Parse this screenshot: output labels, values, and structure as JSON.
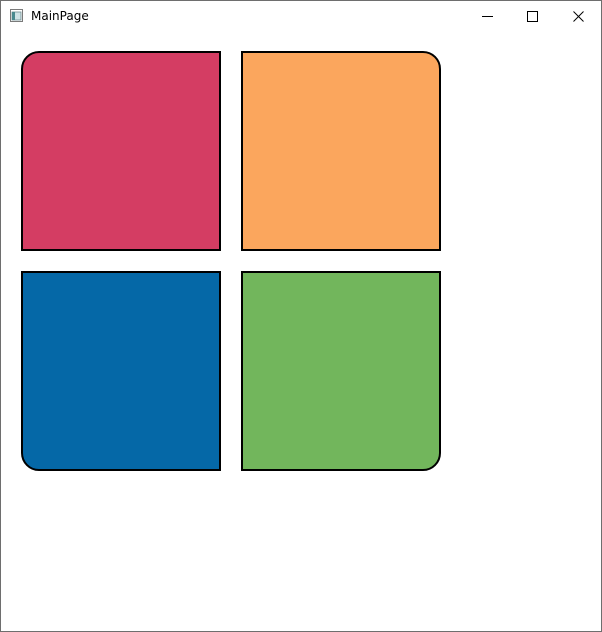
{
  "window": {
    "title": "MainPage",
    "icon": "app-window-icon",
    "controls": {
      "minimize": "minimize-icon",
      "maximize": "maximize-icon",
      "close": "close-icon"
    }
  },
  "tiles": [
    {
      "name": "red",
      "color": "#d43d63"
    },
    {
      "name": "orange",
      "color": "#fba65d"
    },
    {
      "name": "blue",
      "color": "#0568a7"
    },
    {
      "name": "green",
      "color": "#72b65c"
    }
  ]
}
